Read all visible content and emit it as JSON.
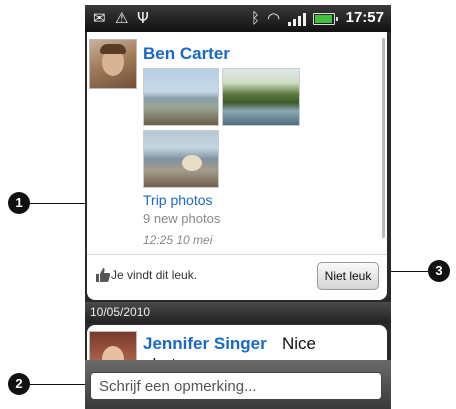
{
  "status_bar": {
    "icons": [
      "mail-icon",
      "alert-icon",
      "usb-icon",
      "bluetooth-icon",
      "wifi-icon",
      "signal-icon",
      "battery-icon"
    ],
    "time": "17:57"
  },
  "post": {
    "author": "Ben Carter",
    "album_title": "Trip photos",
    "photo_count": "9 new photos",
    "timestamp": "12:25 10 mei",
    "like_text": "Je vindt dit leuk.",
    "unlike_label": "Niet leuk"
  },
  "date_header": "10/05/2010",
  "next_post": {
    "author": "Jennifer Singer",
    "text_line1": "Nice",
    "text_line2": "photos"
  },
  "comment": {
    "placeholder": "Schrijf een opmerking..."
  },
  "callouts": [
    "1",
    "2",
    "3"
  ],
  "colors": {
    "link_blue": "#1a68c7",
    "battery_green": "#3fc23f"
  }
}
